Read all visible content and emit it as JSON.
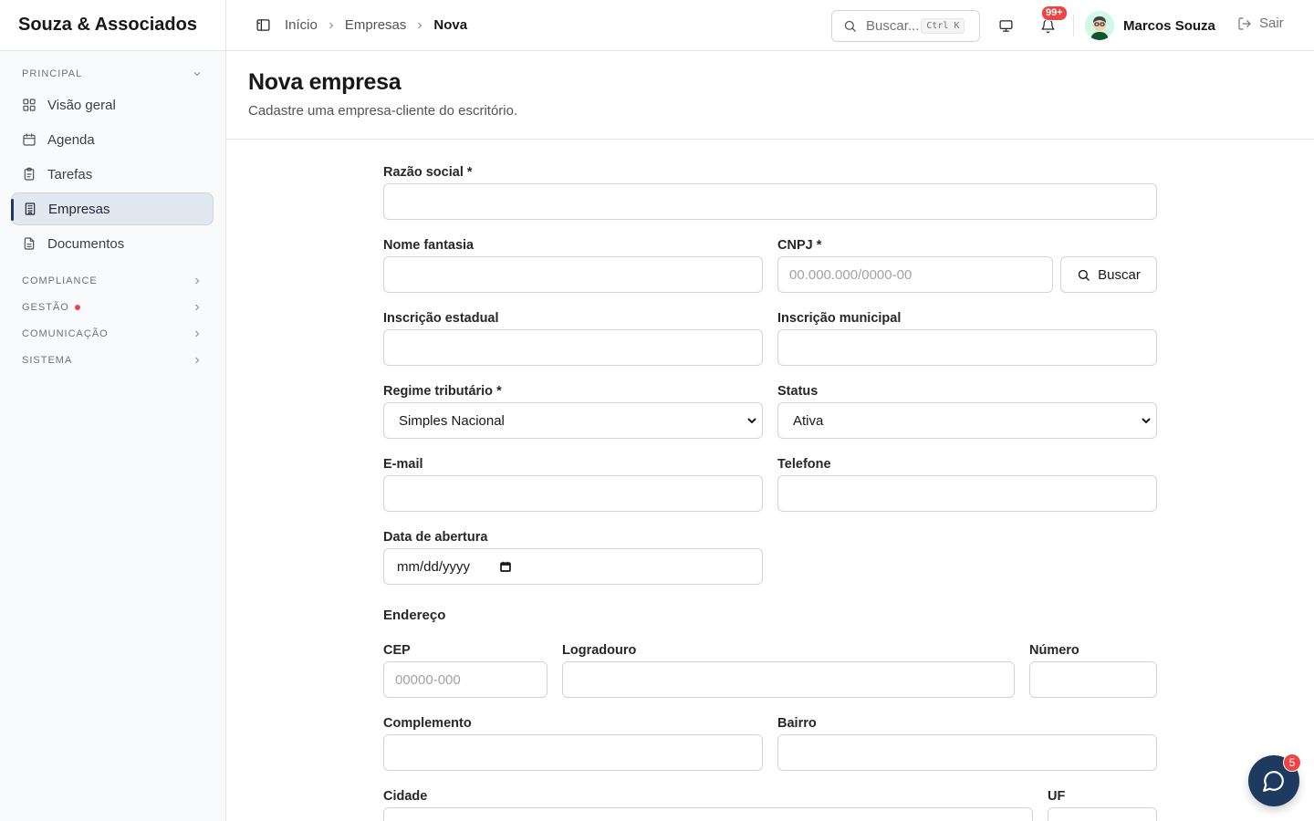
{
  "app": {
    "brand": "Souza & Associados"
  },
  "sidebar": {
    "principal_label": "PRINCIPAL",
    "items": [
      {
        "label": "Visão geral",
        "icon": "grid-icon"
      },
      {
        "label": "Agenda",
        "icon": "calendar-icon"
      },
      {
        "label": "Tarefas",
        "icon": "clipboard-icon"
      },
      {
        "label": "Empresas",
        "icon": "building-icon",
        "active": true
      },
      {
        "label": "Documentos",
        "icon": "file-icon"
      }
    ],
    "sections": [
      {
        "label": "COMPLIANCE"
      },
      {
        "label": "GESTÃO",
        "has_dot": true
      },
      {
        "label": "COMUNICAÇÃO"
      },
      {
        "label": "SISTEMA"
      }
    ]
  },
  "topbar": {
    "breadcrumb": [
      "Início",
      "Empresas",
      "Nova"
    ],
    "search_placeholder": "Buscar...",
    "search_shortcut": "Ctrl K",
    "notifications_badge": "99+",
    "user_name": "Marcos Souza",
    "logout_label": "Sair"
  },
  "page": {
    "title": "Nova empresa",
    "subtitle": "Cadastre uma empresa-cliente do escritório."
  },
  "form": {
    "razao_social": {
      "label": "Razão social *",
      "value": ""
    },
    "nome_fantasia": {
      "label": "Nome fantasia",
      "value": ""
    },
    "cnpj": {
      "label": "CNPJ *",
      "placeholder": "00.000.000/0000-00",
      "button": "Buscar"
    },
    "inscricao_estadual": {
      "label": "Inscrição estadual"
    },
    "inscricao_municipal": {
      "label": "Inscrição municipal"
    },
    "regime": {
      "label": "Regime tributário *",
      "selected": "Simples Nacional"
    },
    "status": {
      "label": "Status",
      "selected": "Ativa"
    },
    "email": {
      "label": "E-mail"
    },
    "telefone": {
      "label": "Telefone"
    },
    "data_abertura": {
      "label": "Data de abertura",
      "placeholder": "mm/dd/yyyy"
    },
    "endereco_title": "Endereço",
    "cep": {
      "label": "CEP",
      "placeholder": "00000-000"
    },
    "logradouro": {
      "label": "Logradouro"
    },
    "numero": {
      "label": "Número"
    },
    "complemento": {
      "label": "Complemento"
    },
    "bairro": {
      "label": "Bairro"
    },
    "cidade": {
      "label": "Cidade"
    },
    "uf": {
      "label": "UF"
    }
  },
  "chat": {
    "badge": "5"
  },
  "colors": {
    "accent": "#1e3a5f",
    "danger": "#ef4444",
    "sidebar_bg": "#f8fafc"
  }
}
